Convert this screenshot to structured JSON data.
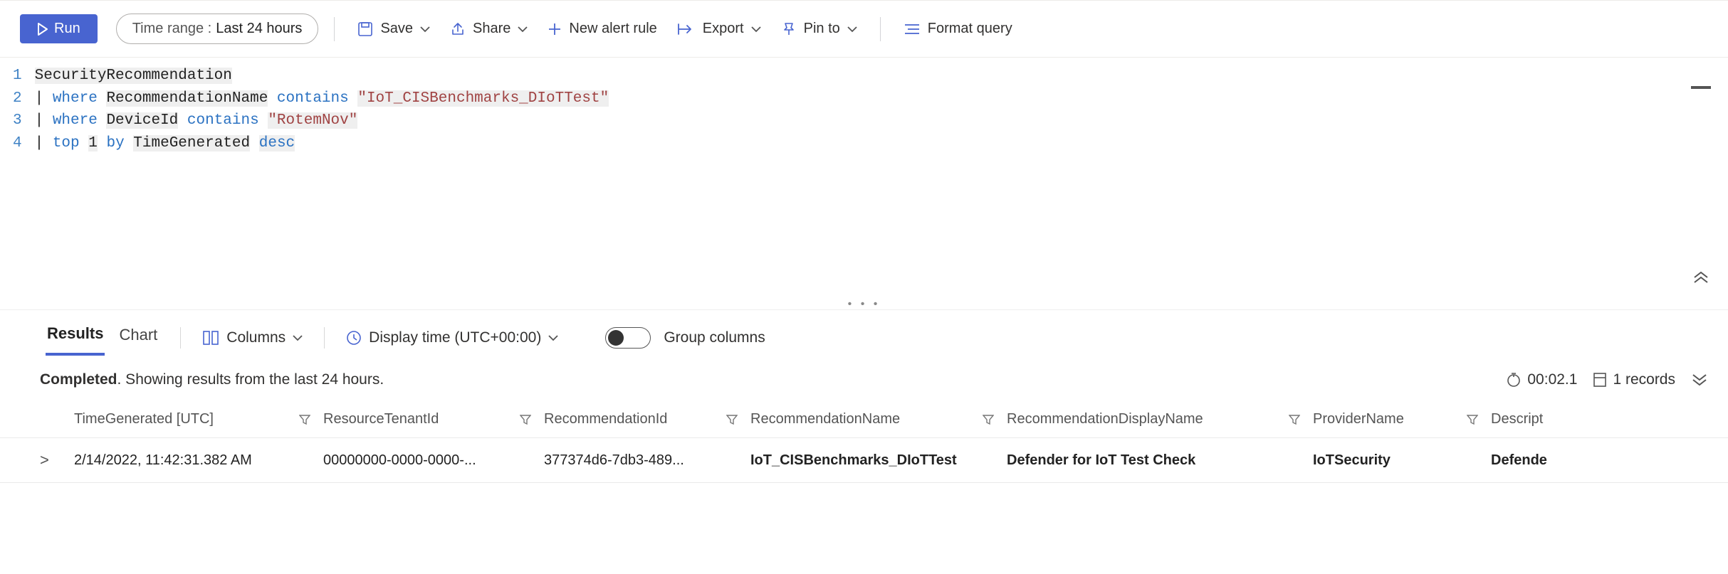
{
  "toolbar": {
    "run_label": "Run",
    "time_range_label": "Time range :",
    "time_range_value": "Last 24 hours",
    "save_label": "Save",
    "share_label": "Share",
    "new_alert_label": "New alert rule",
    "export_label": "Export",
    "pin_label": "Pin to",
    "format_label": "Format query"
  },
  "editor": {
    "lines": {
      "l1": {
        "num": "1",
        "t1": "SecurityRecommendation"
      },
      "l2": {
        "num": "2",
        "pipe": "|",
        "kw1": "where",
        "id1": "RecommendationName",
        "kw2": "contains",
        "str1": "\"IoT_CISBenchmarks_DIoTTest\""
      },
      "l3": {
        "num": "3",
        "pipe": "|",
        "kw1": "where",
        "id1": "DeviceId",
        "kw2": "contains",
        "str1": "\"RotemNov\""
      },
      "l4": {
        "num": "4",
        "pipe": "|",
        "kw1": "top",
        "n": "1",
        "kw2": "by",
        "id1": "TimeGenerated",
        "kw3": "desc"
      }
    }
  },
  "results": {
    "tabs": {
      "results": "Results",
      "chart": "Chart"
    },
    "columns_label": "Columns",
    "display_time_label": "Display time (UTC+00:00)",
    "group_columns_label": "Group columns"
  },
  "status": {
    "completed": "Completed",
    "suffix": ". Showing results from the last 24 hours.",
    "elapsed": "00:02.1",
    "records": "1 records"
  },
  "grid": {
    "headers": {
      "time": "TimeGenerated [UTC]",
      "tenant": "ResourceTenantId",
      "recid": "RecommendationId",
      "recname": "RecommendationName",
      "dispname": "RecommendationDisplayName",
      "provider": "ProviderName",
      "desc": "Descript"
    },
    "row": {
      "expand": ">",
      "time": "2/14/2022, 11:42:31.382 AM",
      "tenant": "00000000-0000-0000-...",
      "recid": "377374d6-7db3-489...",
      "recname": "IoT_CISBenchmarks_DIoTTest",
      "dispname": "Defender for IoT Test Check",
      "provider": "IoTSecurity",
      "desc": "Defende"
    }
  }
}
